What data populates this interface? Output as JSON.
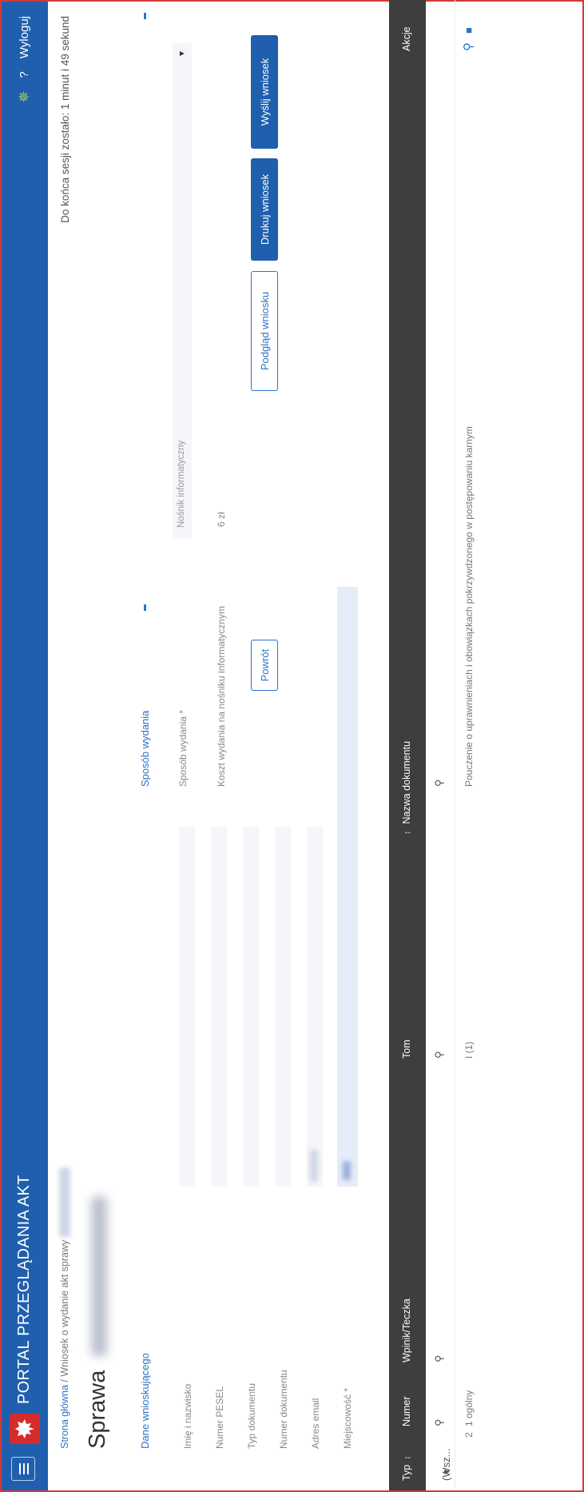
{
  "header": {
    "app_title": "PORTAL PRZEGLĄDANIA AKT",
    "gear_icon": "✵",
    "help": "?",
    "logout": "Wyloguj"
  },
  "breadcrumb": {
    "home": "Strona główna",
    "separator": "/",
    "current": "Wniosek o wydanie akt sprawy"
  },
  "session": "Do końca sesji zostało: 1 minut i 49 sekund",
  "page_title": "Sprawa",
  "applicant": {
    "heading": "Dane wnioskującego",
    "fields": [
      {
        "label": "Imię i nazwisko"
      },
      {
        "label": "Numer PESEL"
      },
      {
        "label": "Typ dokumentu"
      },
      {
        "label": "Numer dokumentu"
      },
      {
        "label": "Adres email"
      },
      {
        "label": "Miejscowość *"
      }
    ]
  },
  "delivery": {
    "heading": "Sposób wydania",
    "method_label": "Sposób wydania *",
    "method_value": "Nośnik informatyczny",
    "cost_label": "Koszt wydania na nośniku informatycznym",
    "cost_value": "6 zł"
  },
  "buttons": {
    "back": "Powrót",
    "preview": "Podgląd wniosku",
    "print": "Drukuj wniosek",
    "send": "Wyślij wniosek"
  },
  "table": {
    "columns": [
      "Typ",
      "Numer",
      "Wpinik/Teczka",
      "Tom",
      "Nazwa dokumentu",
      "Akcje"
    ],
    "filter_type": "(Wsz...",
    "filter_caret": "▾",
    "search_icon": "⚲",
    "rows": [
      {
        "number": "2",
        "folder": "1 ogólny",
        "volume": "I (1)",
        "name": "Pouczenie o uprawnieniach i obowiązkach pokrzywdzonego w postępowaniu karnym"
      }
    ]
  }
}
